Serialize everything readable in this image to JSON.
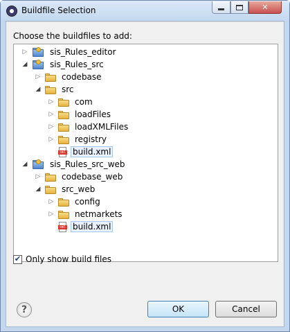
{
  "window": {
    "title": "Buildfile Selection"
  },
  "dialog": {
    "instruction": "Choose the buildfiles to add:",
    "tree": [
      {
        "label": "sis_Rules_editor",
        "icon": "project-folder-icon",
        "twisty": "collapsed",
        "depth": 0,
        "selected": false
      },
      {
        "label": "sis_Rules_src",
        "icon": "project-folder-icon",
        "twisty": "expanded",
        "depth": 0,
        "selected": false
      },
      {
        "label": "codebase",
        "icon": "folder-icon",
        "twisty": "collapsed",
        "depth": 1,
        "selected": false
      },
      {
        "label": "src",
        "icon": "folder-icon",
        "twisty": "expanded",
        "depth": 1,
        "selected": false
      },
      {
        "label": "com",
        "icon": "folder-icon",
        "twisty": "collapsed",
        "depth": 2,
        "selected": false
      },
      {
        "label": "loadFiles",
        "icon": "folder-icon",
        "twisty": "collapsed",
        "depth": 2,
        "selected": false
      },
      {
        "label": "loadXMLFiles",
        "icon": "folder-icon",
        "twisty": "collapsed",
        "depth": 2,
        "selected": false
      },
      {
        "label": "registry",
        "icon": "folder-icon",
        "twisty": "collapsed",
        "depth": 2,
        "selected": false
      },
      {
        "label": "build.xml",
        "icon": "xml-file-icon",
        "twisty": "none",
        "depth": 2,
        "selected": true
      },
      {
        "label": "sis_Rules_src_web",
        "icon": "project-folder-icon",
        "twisty": "expanded",
        "depth": 0,
        "selected": false
      },
      {
        "label": "codebase_web",
        "icon": "folder-icon",
        "twisty": "collapsed",
        "depth": 1,
        "selected": false
      },
      {
        "label": "src_web",
        "icon": "folder-icon",
        "twisty": "expanded",
        "depth": 1,
        "selected": false
      },
      {
        "label": "config",
        "icon": "folder-icon",
        "twisty": "collapsed",
        "depth": 2,
        "selected": false
      },
      {
        "label": "netmarkets",
        "icon": "folder-icon",
        "twisty": "collapsed",
        "depth": 2,
        "selected": false
      },
      {
        "label": "build.xml",
        "icon": "xml-file-icon",
        "twisty": "none",
        "depth": 2,
        "selected": true
      }
    ],
    "only_show_build_files": {
      "label": "Only show build files",
      "checked": true
    },
    "buttons": {
      "ok": "OK",
      "cancel": "Cancel"
    }
  }
}
